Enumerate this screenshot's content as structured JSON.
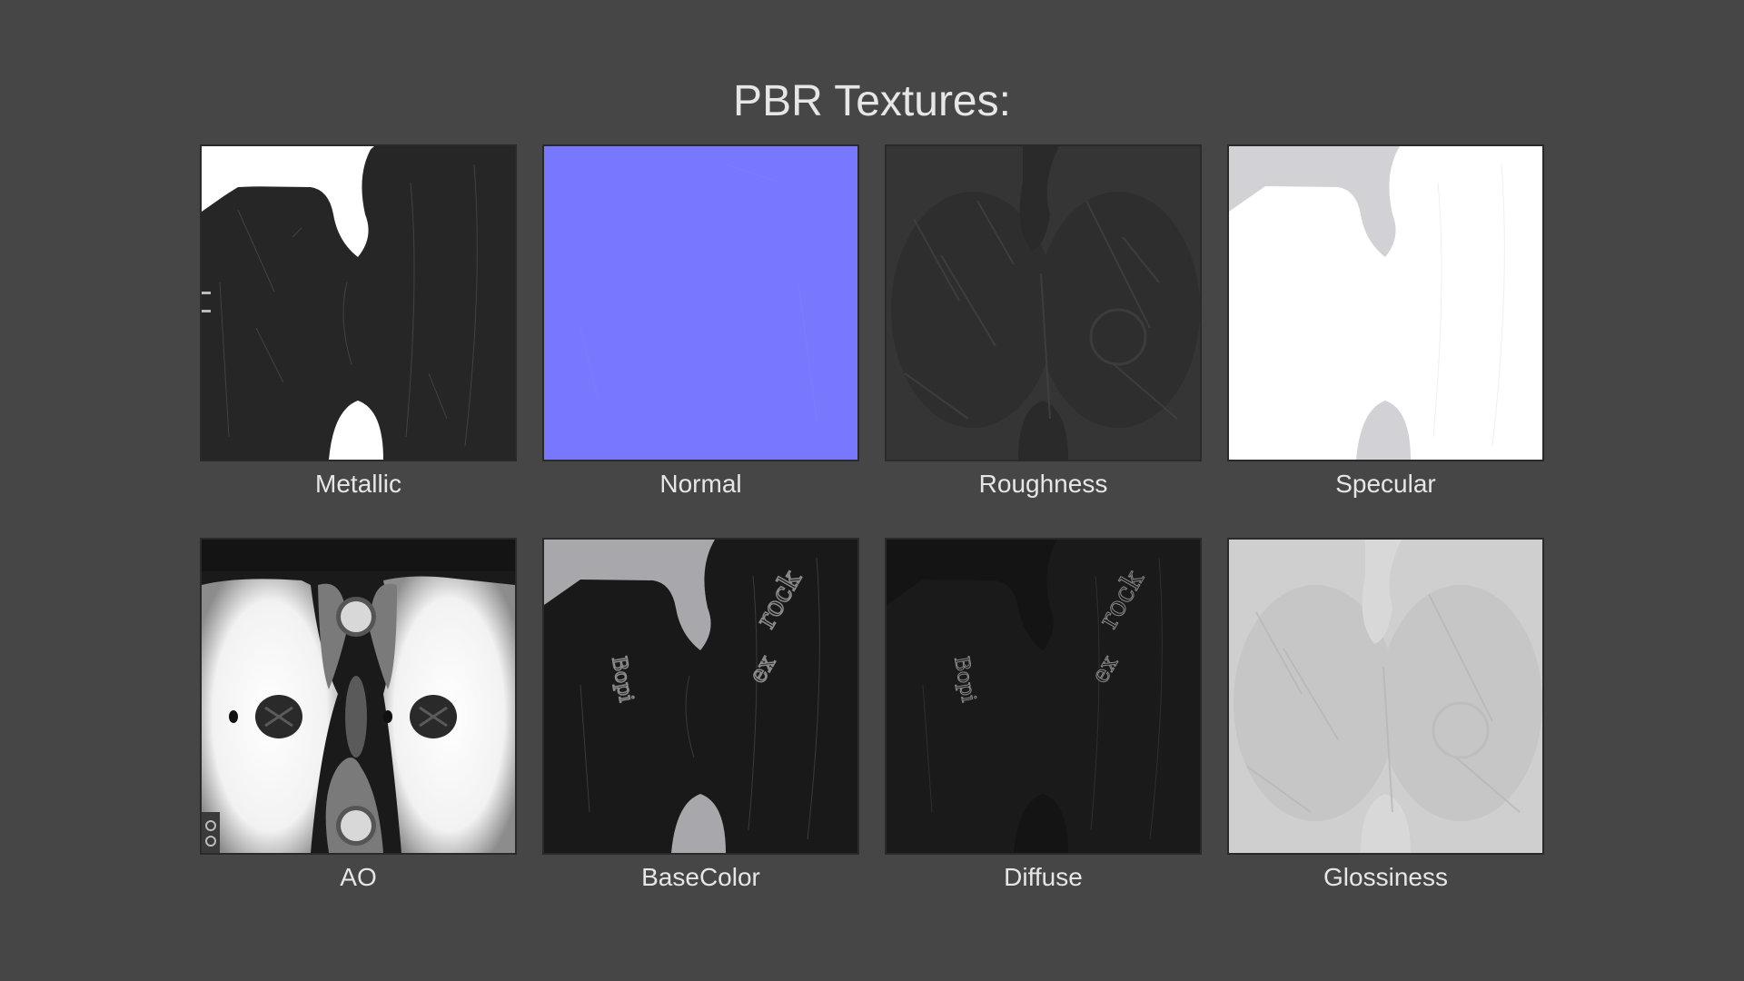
{
  "title": "PBR Textures:",
  "textures": [
    {
      "label": "Metallic",
      "icon": "metallic-map"
    },
    {
      "label": "Normal",
      "icon": "normal-map",
      "color": "#7878fe"
    },
    {
      "label": "Roughness",
      "icon": "roughness-map"
    },
    {
      "label": "Specular",
      "icon": "specular-map"
    },
    {
      "label": "AO",
      "icon": "ambient-occlusion-map"
    },
    {
      "label": "BaseColor",
      "icon": "basecolor-map"
    },
    {
      "label": "Diffuse",
      "icon": "diffuse-map"
    },
    {
      "label": "Glossiness",
      "icon": "glossiness-map"
    }
  ],
  "colors": {
    "background": "#464646",
    "text": "#e6e6e6",
    "normal_map": "#7878fe"
  }
}
